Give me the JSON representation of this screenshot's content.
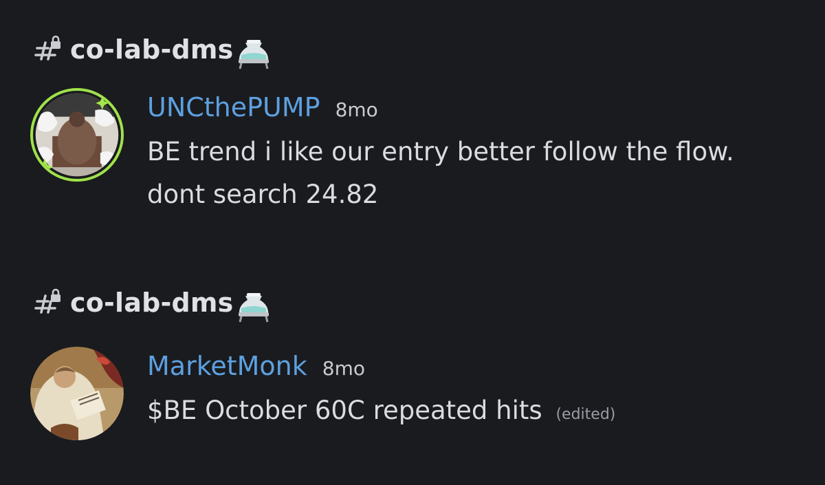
{
  "colors": {
    "background": "#1a1b1f",
    "username": "#5da0e0",
    "avatar_ring": "#9fe24a"
  },
  "blocks": [
    {
      "channel": {
        "icon": "locked-hashtag-icon",
        "name": "co-lab-dms",
        "emoji": "flask-emoji"
      },
      "message": {
        "avatar": "avatar-uncthepump",
        "username": "UNCthePUMP",
        "timestamp": "8mo",
        "text": "BE trend i like our entry better follow the flow. dont search 24.82",
        "edited": ""
      }
    },
    {
      "channel": {
        "icon": "locked-hashtag-icon",
        "name": "co-lab-dms",
        "emoji": "flask-emoji"
      },
      "message": {
        "avatar": "avatar-marketmonk",
        "username": "MarketMonk",
        "timestamp": "8mo",
        "text": "$BE October 60C repeated hits",
        "edited": "(edited)"
      }
    }
  ]
}
